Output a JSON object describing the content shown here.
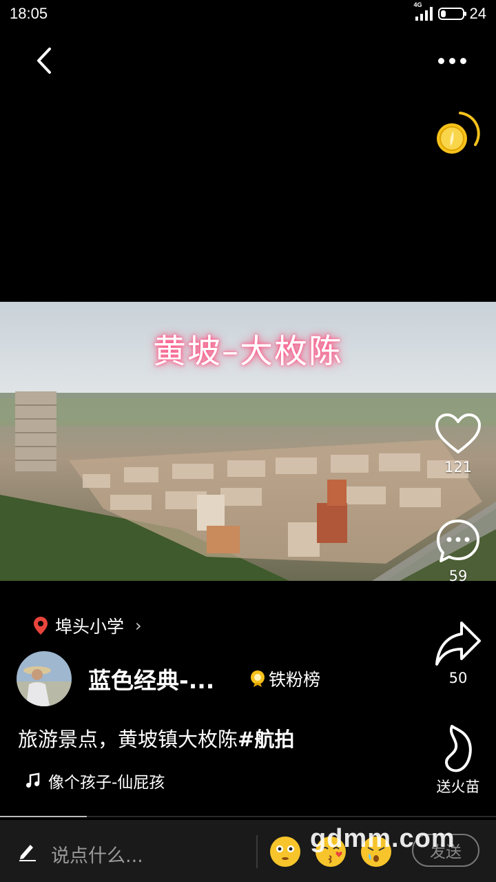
{
  "status_bar": {
    "time": "18:05",
    "network": "4G",
    "battery_level": "24",
    "battery_fraction": 0.24
  },
  "video": {
    "overlay_title": "黄坡–大枚陈"
  },
  "actions": {
    "like_count": "121",
    "comment_count": "59",
    "share_count": "50",
    "gift_label": "送火苗"
  },
  "post": {
    "location": "埠头小学",
    "author_name": "蓝色经典-...",
    "fan_badge": "铁粉榜",
    "caption_text": "旅游景点，黄坡镇大枚陈",
    "caption_tag": "#航拍",
    "music": "像个孩子-仙屁孩"
  },
  "playback": {
    "progress_fraction": 0.175
  },
  "comment_bar": {
    "placeholder": "说点什么...",
    "send_label": "发送"
  },
  "watermark": "gdmm.com",
  "colors": {
    "location_pin": "#e8453c",
    "coin": "#f6c21c",
    "title_glow": "#ff3a70"
  }
}
